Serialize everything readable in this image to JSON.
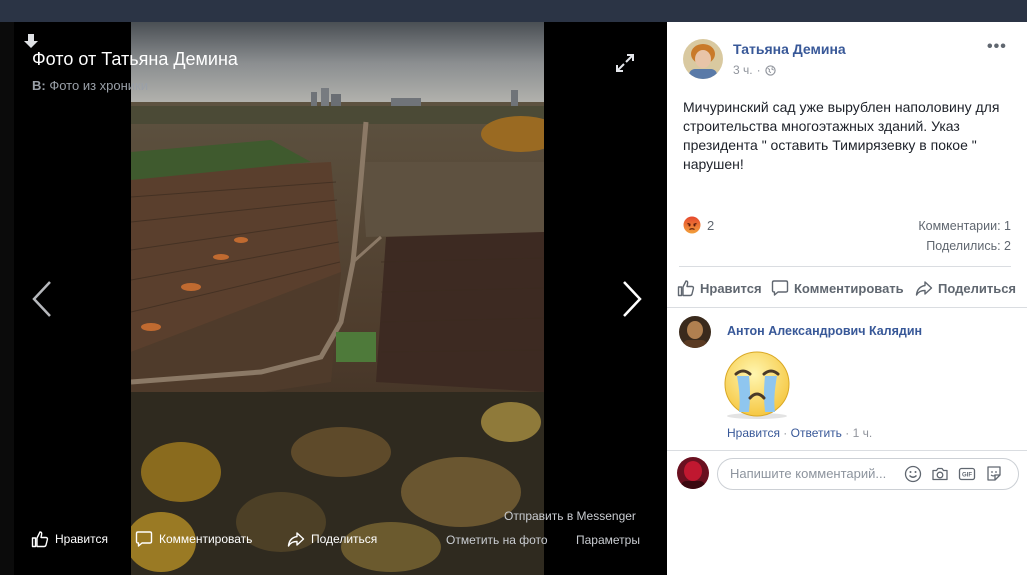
{
  "viewer": {
    "title": "Фото от Татьяна Демина",
    "subtitle_prefix": "В:",
    "subtitle": "Фото из хроники",
    "toolbar": {
      "like": "Нравится",
      "comment": "Комментировать",
      "share": "Поделиться",
      "send_messenger": "Отправить в Messenger",
      "tag_photo": "Отметить на фото",
      "options": "Параметры"
    }
  },
  "post": {
    "author": "Татьяна Демина",
    "time": "3 ч.",
    "text": "Мичуринский сад уже вырублен наполовину для строительства многоэтажных зданий. Указ президента \" оставить Тимирязевку в покое \" нарушен!",
    "reaction_count": "2",
    "comments_count": "Комментарии: 1",
    "shares_count": "Поделились: 2",
    "actions": {
      "like": "Нравится",
      "comment": "Комментировать",
      "share": "Поделиться"
    }
  },
  "comment": {
    "author": "Антон Александрович Калядин",
    "like": "Нравится",
    "reply": "Ответить",
    "time": "1 ч."
  },
  "composer": {
    "placeholder": "Напишите комментарий..."
  }
}
